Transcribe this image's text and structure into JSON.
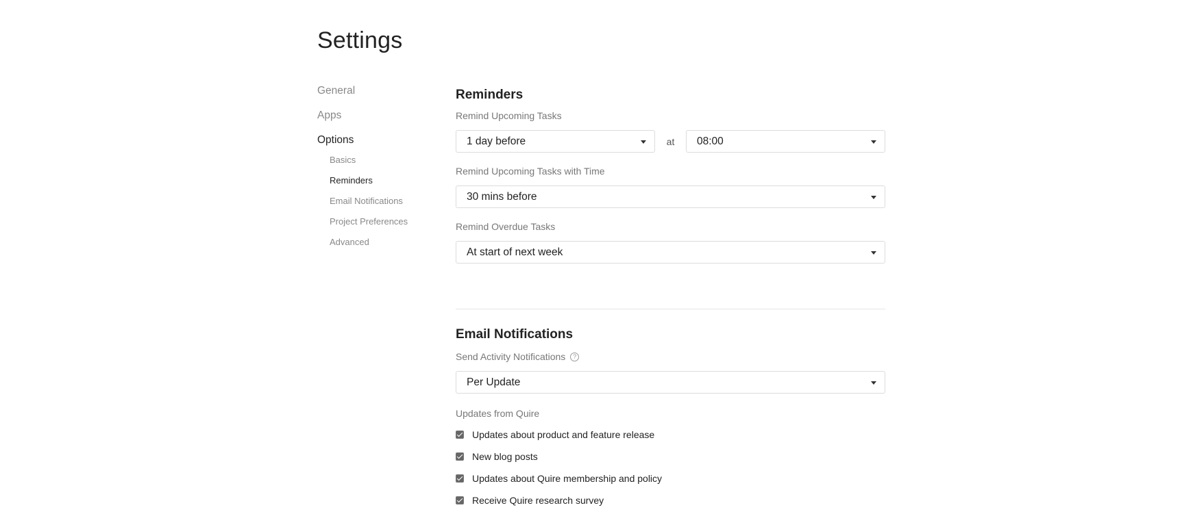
{
  "page": {
    "title": "Settings"
  },
  "sidebar": {
    "items": [
      {
        "label": "General"
      },
      {
        "label": "Apps"
      },
      {
        "label": "Options"
      }
    ],
    "subitems": [
      {
        "label": "Basics"
      },
      {
        "label": "Reminders"
      },
      {
        "label": "Email Notifications"
      },
      {
        "label": "Project Preferences"
      },
      {
        "label": "Advanced"
      }
    ]
  },
  "reminders": {
    "title": "Reminders",
    "upcoming": {
      "label": "Remind Upcoming Tasks",
      "value": "1 day before",
      "at_label": "at",
      "time_value": "08:00"
    },
    "upcoming_with_time": {
      "label": "Remind Upcoming Tasks with Time",
      "value": "30 mins before"
    },
    "overdue": {
      "label": "Remind Overdue Tasks",
      "value": "At start of next week"
    }
  },
  "email": {
    "title": "Email Notifications",
    "activity": {
      "label": "Send Activity Notifications",
      "help_glyph": "?",
      "value": "Per Update"
    },
    "updates_label": "Updates from Quire",
    "checkboxes": [
      {
        "label": "Updates about product and feature release",
        "checked": true
      },
      {
        "label": "New blog posts",
        "checked": true
      },
      {
        "label": "Updates about Quire membership and policy",
        "checked": true
      },
      {
        "label": "Receive Quire research survey",
        "checked": true
      }
    ]
  },
  "icons": {
    "dropdown": "chevron-down-icon",
    "help": "help-icon",
    "checkbox": "checkbox-checked-icon"
  }
}
